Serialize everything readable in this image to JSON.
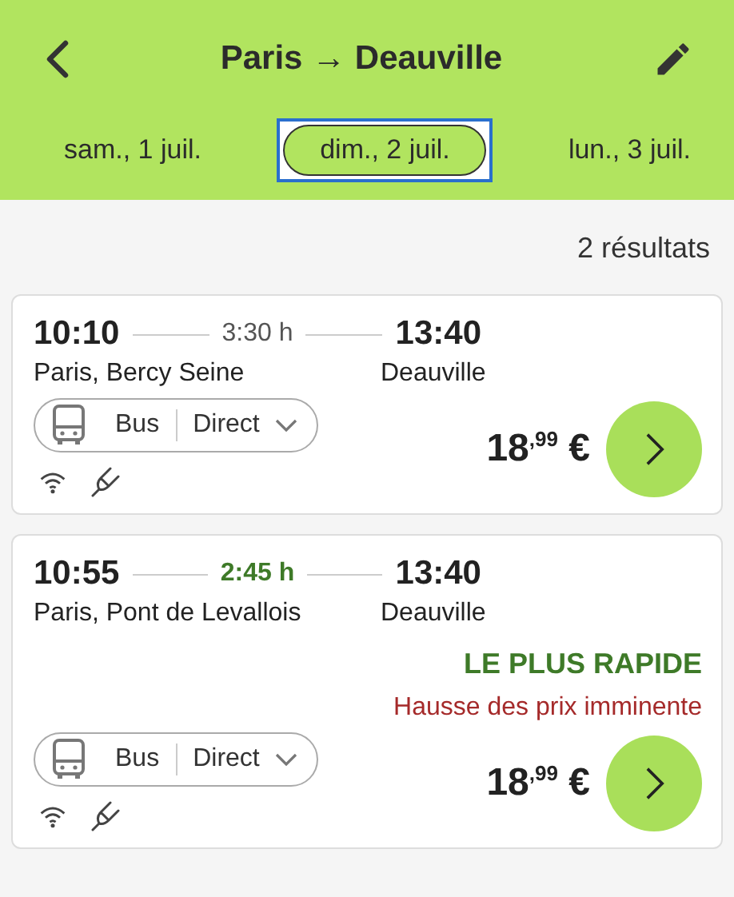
{
  "header": {
    "title": "Paris → Deauville"
  },
  "dates": [
    {
      "label": "sam., 1 juil.",
      "selected": false
    },
    {
      "label": "dim., 2 juil.",
      "selected": true
    },
    {
      "label": "lun., 3 juil.",
      "selected": false
    }
  ],
  "result_count": "2 résultats",
  "results": [
    {
      "departure_time": "10:10",
      "duration": "3:30 h",
      "fastest": false,
      "arrival_time": "13:40",
      "origin": "Paris, Bercy Seine",
      "destination": "Deauville",
      "mode": "Bus",
      "connection": "Direct",
      "price": "18$^{,99}$ €"
    },
    {
      "departure_time": "10:55",
      "duration": "2:45 h",
      "fastest": true,
      "arrival_time": "13:40",
      "origin": "Paris, Pont de Levallois",
      "destination": "Deauville",
      "badge": "LE PLUS RAPIDE",
      "warning": "Hausse des prix imminente",
      "mode": "Bus",
      "connection": "Direct",
      "price": "18$^{,99}$ €"
    }
  ]
}
